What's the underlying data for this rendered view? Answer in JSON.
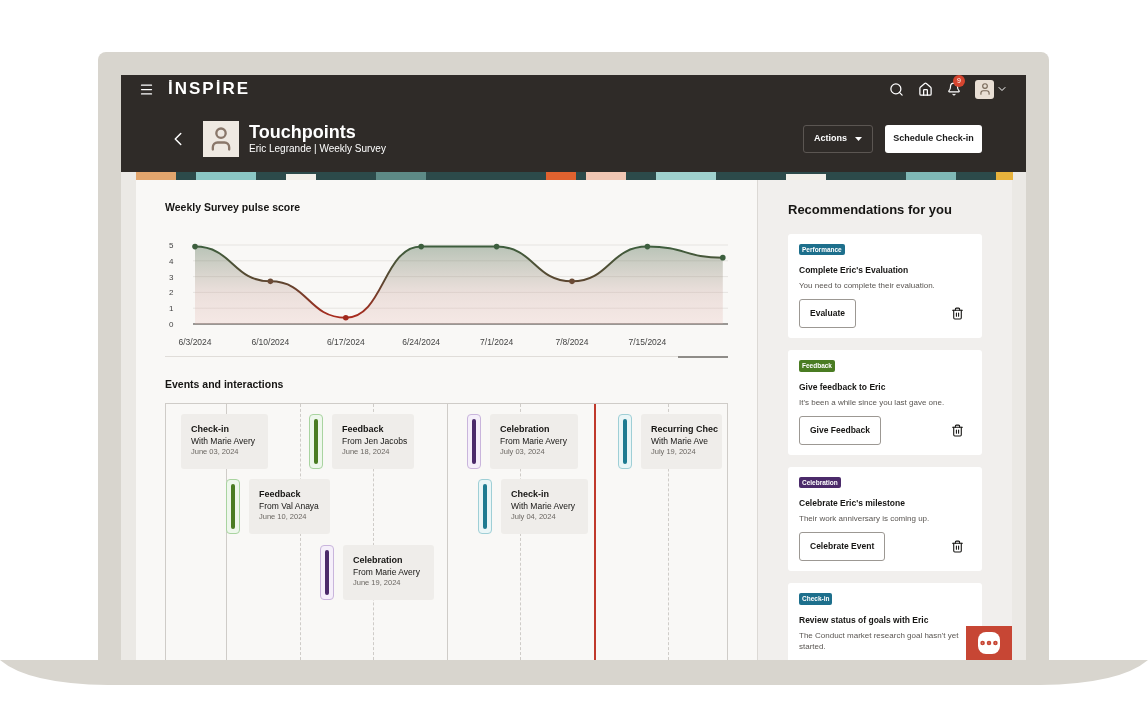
{
  "app": {
    "logo": "İNSPİRE",
    "notification_count": "9"
  },
  "header": {
    "title": "Touchpoints",
    "subtitle": "Eric Legrande | Weekly Survey",
    "actions_label": "Actions",
    "primary_button": "Schedule Check-in"
  },
  "pulse": {
    "title": "Weekly Survey pulse score",
    "chart_data": {
      "type": "area",
      "grid": true,
      "categories": [
        "6/3/2024",
        "6/10/2024",
        "6/17/2024",
        "6/24/2024",
        "7/1/2024",
        "7/8/2024",
        "7/15/2024",
        null
      ],
      "series": [
        {
          "color": "#3d5f3e",
          "values": [
            4.9,
            2.7,
            0.4,
            4.9,
            4.9,
            2.7,
            4.9,
            4.2
          ]
        }
      ],
      "ylim": [
        0,
        5
      ],
      "yticks": [
        0,
        1,
        2,
        3,
        4,
        5
      ]
    }
  },
  "events": {
    "title": "Events and interactions",
    "items": [
      {
        "kind": "checkin",
        "title": "Check-in",
        "person": "With Marie Avery",
        "date": "June 03, 2024"
      },
      {
        "kind": "feedback",
        "title": "Feedback",
        "person": "From Jen Jacobs",
        "date": "June 18, 2024"
      },
      {
        "kind": "celebration",
        "title": "Celebration",
        "person": "From Marie Avery",
        "date": "July 03, 2024"
      },
      {
        "kind": "checkin",
        "title": "Recurring Chec",
        "person": "With Marie Ave",
        "date": "July 19, 2024"
      },
      {
        "kind": "feedback",
        "title": "Feedback",
        "person": "From Val Anaya",
        "date": "June 10, 2024"
      },
      {
        "kind": "checkin",
        "title": "Check-in",
        "person": "With Marie Avery",
        "date": "July 04, 2024"
      },
      {
        "kind": "celebration",
        "title": "Celebration",
        "person": "From Marie Avery",
        "date": "June 19, 2024"
      }
    ]
  },
  "recommendations": {
    "title": "Recommendations for you",
    "items": [
      {
        "tag": "Performance",
        "color": "#1d6f8c",
        "title": "Complete Eric's Evaluation",
        "text": "You need to complete their evaluation.",
        "button": "Evaluate"
      },
      {
        "tag": "Feedback",
        "color": "#4a7c22",
        "title": "Give feedback to Eric",
        "text": "It's been a while since you last gave one.",
        "button": "Give Feedback"
      },
      {
        "tag": "Celebration",
        "color": "#4b2a6a",
        "title": "Celebrate Eric's milestone",
        "text": "Their work anniversary is coming up.",
        "button": "Celebrate Event"
      },
      {
        "tag": "Check-in",
        "color": "#1d6f8c",
        "title": "Review status of goals with Eric",
        "text": "The Conduct market research goal hasn't yet started."
      }
    ]
  }
}
